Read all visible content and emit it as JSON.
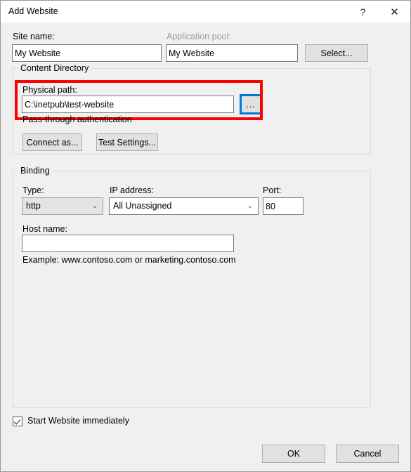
{
  "window": {
    "title": "Add Website",
    "help_icon": "?",
    "close_icon": "✕"
  },
  "site_name": {
    "label": "Site name:",
    "value": "My Website",
    "placeholder": ""
  },
  "application_pool": {
    "label": "Application pool:",
    "value": "My Website",
    "select_button": "Select..."
  },
  "content_directory": {
    "title": "Content Directory",
    "physical_path": {
      "label": "Physical path:",
      "value": "C:\\inetpub\\test-website",
      "browse_button": "..."
    },
    "pass_through_label": "Pass-through authentication",
    "connect_as_button": "Connect as...",
    "test_settings_button": "Test Settings..."
  },
  "binding": {
    "title": "Binding",
    "type": {
      "label": "Type:",
      "value": "http",
      "chevron": "⌄"
    },
    "ip_address": {
      "label": "IP address:",
      "value": "All Unassigned",
      "chevron": "⌄"
    },
    "port": {
      "label": "Port:",
      "value": "80"
    },
    "host_name": {
      "label": "Host name:",
      "value": "",
      "placeholder": ""
    },
    "example_text": "Example: www.contoso.com or marketing.contoso.com"
  },
  "start_website": {
    "label": "Start Website immediately",
    "checked": true
  },
  "footer": {
    "ok_button": "OK",
    "cancel_button": "Cancel"
  },
  "annotation": {
    "highlight_color": "#ff0000",
    "focus_color": "#0078d7"
  }
}
